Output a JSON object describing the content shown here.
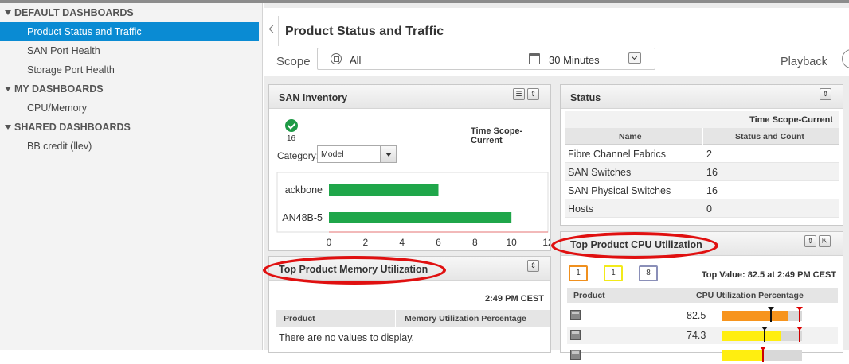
{
  "sidebar": {
    "sections": [
      {
        "label": "DEFAULT DASHBOARDS",
        "items": [
          "Product Status and Traffic",
          "SAN Port Health",
          "Storage Port Health"
        ]
      },
      {
        "label": "MY DASHBOARDS",
        "items": [
          "CPU/Memory"
        ]
      },
      {
        "label": "SHARED DASHBOARDS",
        "items": [
          "BB credit (llev)"
        ]
      }
    ],
    "active_item": "Product Status and Traffic"
  },
  "header": {
    "title": "Product Status and Traffic"
  },
  "scope": {
    "label": "Scope",
    "value": "All",
    "time": "30 Minutes",
    "playback": "Playback"
  },
  "san_inventory": {
    "title": "SAN Inventory",
    "ok_count": "16",
    "time_scope": "Time Scope-Current",
    "category_label": "Category:",
    "category_value": "Model",
    "chart_data": {
      "type": "bar",
      "orientation": "horizontal",
      "categories": [
        "ackbone",
        "AN48B-5"
      ],
      "values": [
        6,
        10
      ],
      "xlim": [
        0,
        12
      ],
      "xticks": [
        "0",
        "2",
        "4",
        "6",
        "8",
        "10",
        "12"
      ],
      "color": "#1fa64a"
    }
  },
  "status": {
    "title": "Status",
    "time_scope": "Time Scope-Current",
    "columns": [
      "Name",
      "Status and Count"
    ],
    "rows": [
      [
        "Fibre Channel Fabrics",
        "2"
      ],
      [
        "SAN Switches",
        "16"
      ],
      [
        "SAN Physical Switches",
        "16"
      ],
      [
        "Hosts",
        "0"
      ]
    ]
  },
  "memory": {
    "title": "Top Product Memory Utilization",
    "time": "2:49 PM CEST",
    "columns": [
      "Product",
      "Memory Utilization Percentage"
    ],
    "empty": "There are no values to display."
  },
  "cpu": {
    "title": "Top Product CPU Utilization",
    "badges": [
      {
        "value": "1",
        "color": "#f0901e"
      },
      {
        "value": "1",
        "color": "#f2ea1a"
      },
      {
        "value": "8",
        "color": "#8a8fb8"
      }
    ],
    "top_value": "Top Value: 82.5 at 2:49 PM CEST",
    "columns": [
      "Product",
      "CPU Utilization Percentage"
    ],
    "rows": [
      {
        "value": "82.5",
        "color": "#f7941d"
      },
      {
        "value": "74.3",
        "color": "#ffee10"
      }
    ]
  },
  "colors": {
    "accent": "#0a8bd3",
    "annotation": "#e01010"
  }
}
